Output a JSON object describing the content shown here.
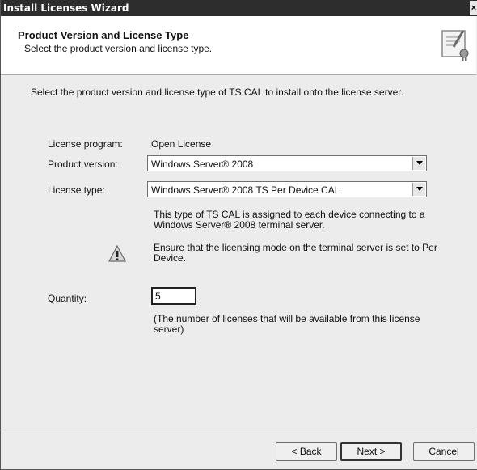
{
  "window": {
    "title": "Install Licenses Wizard",
    "close_glyph": "×"
  },
  "header": {
    "title": "Product Version and License Type",
    "subtitle": "Select the product version and license type.",
    "icon": "license-certificate-icon"
  },
  "intro": "Select the product version and license type of TS CAL to install onto the license server.",
  "form": {
    "license_program_label": "License program:",
    "license_program_value": "Open License",
    "product_version_label": "Product version:",
    "product_version_value": "Windows Server® 2008",
    "license_type_label": "License type:",
    "license_type_value": "Windows Server® 2008 TS Per Device CAL",
    "description": "This type of TS CAL is assigned to each device connecting to a Windows Server® 2008 terminal server.",
    "warning": "Ensure that the licensing mode on the terminal server is set to Per Device.",
    "warning_icon": "warning-icon",
    "quantity_label": "Quantity:",
    "quantity_value": "5",
    "quantity_note": "(The number of licenses that will be available from this license server)"
  },
  "buttons": {
    "back": "< Back",
    "next": "Next >",
    "cancel": "Cancel"
  }
}
